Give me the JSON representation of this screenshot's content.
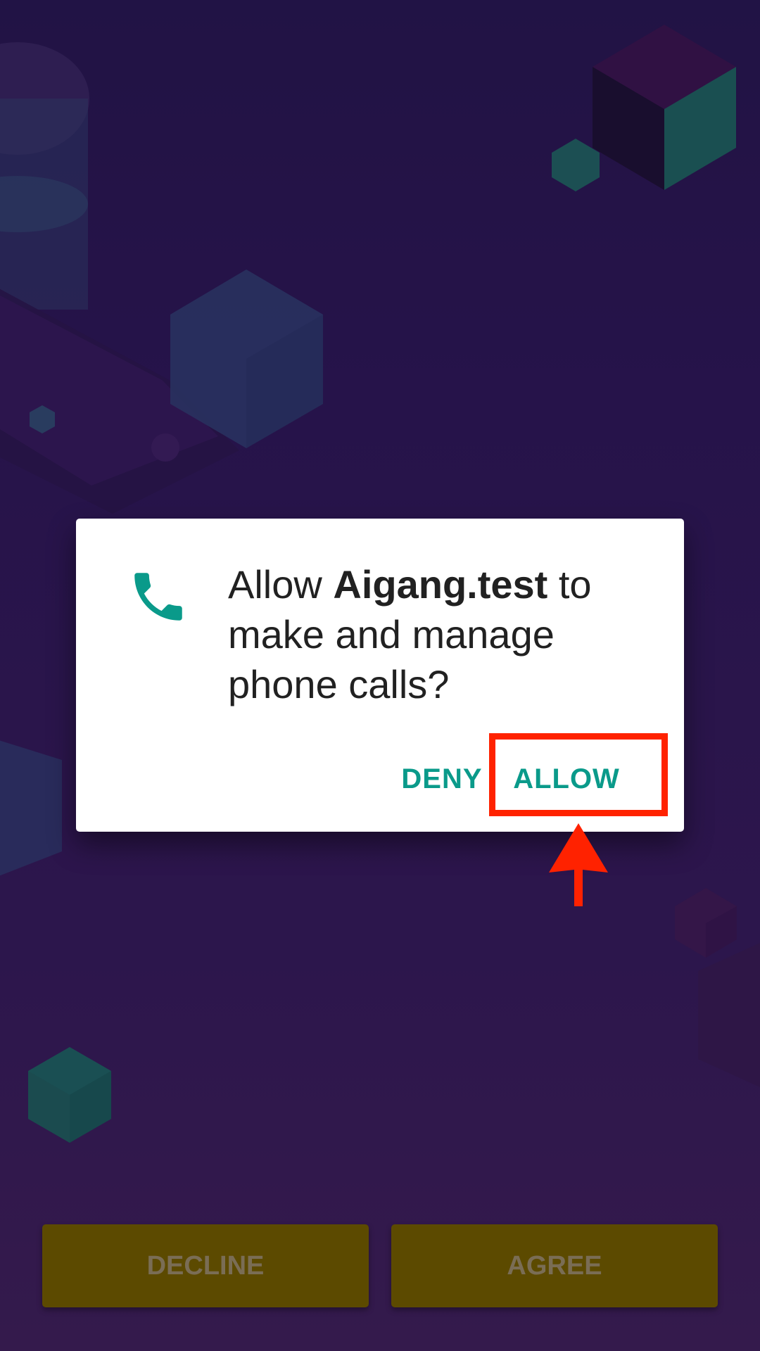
{
  "dialog": {
    "message_prefix": "Allow ",
    "app_name": "Aigang.test",
    "message_suffix": " to make and manage phone calls?",
    "deny_label": "DENY",
    "allow_label": "ALLOW",
    "icon": "phone-icon",
    "accent_color": "#0a9a8a"
  },
  "footer": {
    "decline_label": "DECLINE",
    "agree_label": "AGREE",
    "button_color": "#5c4a00"
  },
  "annotation": {
    "highlight_color": "#ff2200",
    "icon": "arrow-up-icon"
  }
}
